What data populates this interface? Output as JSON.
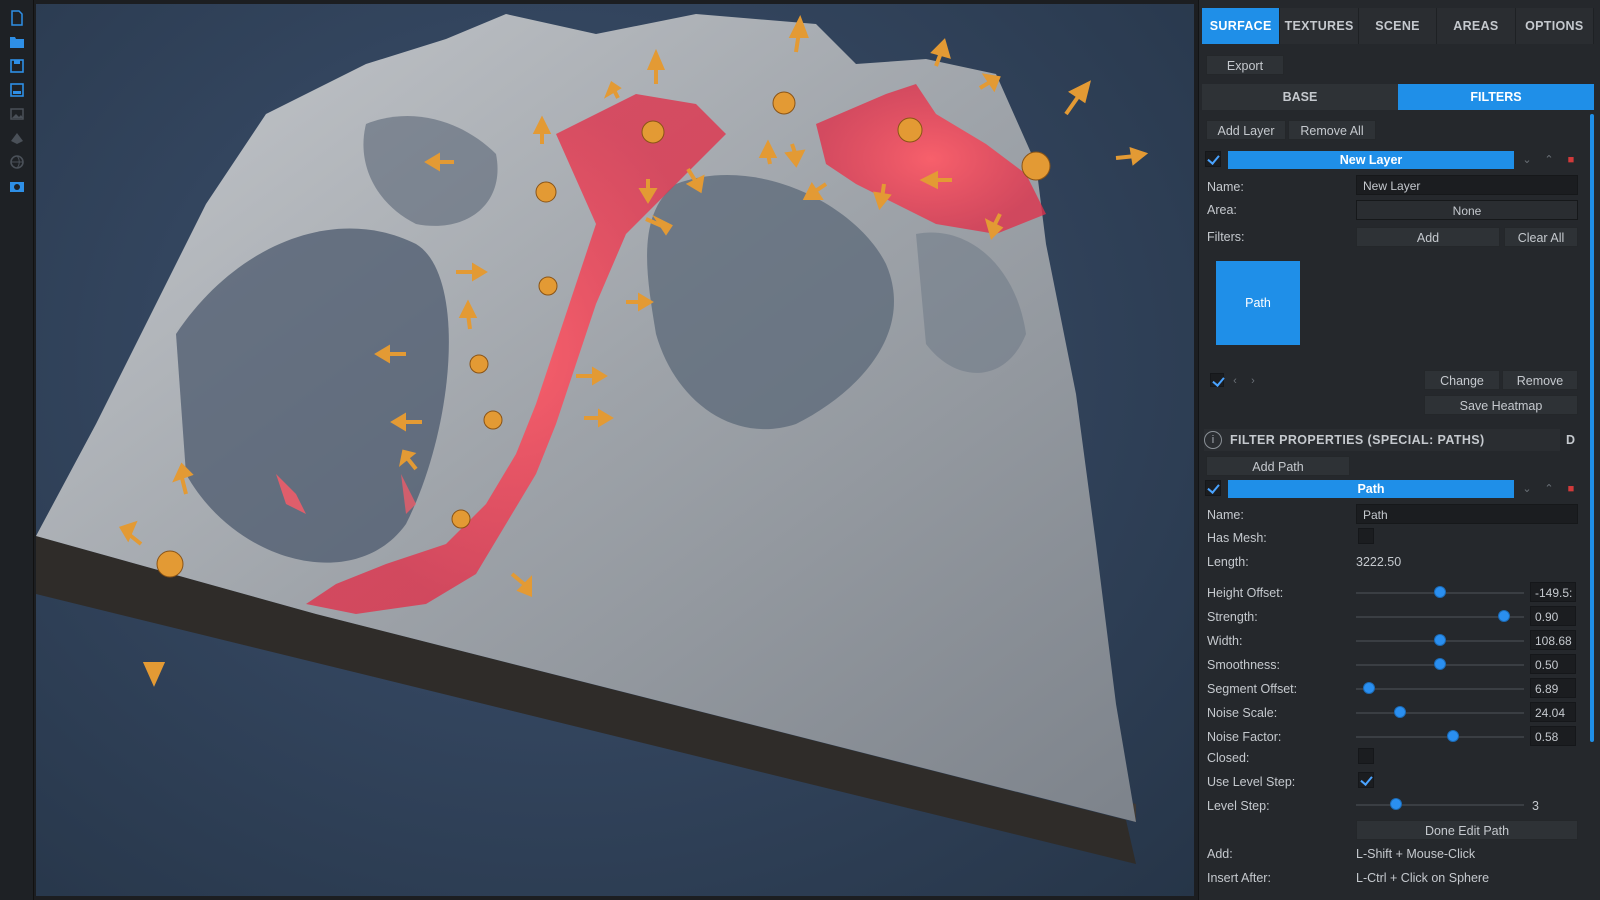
{
  "toolbar": {
    "tools": [
      {
        "name": "new-file-icon"
      },
      {
        "name": "open-folder-icon"
      },
      {
        "name": "save-icon"
      },
      {
        "name": "save-as-icon"
      },
      {
        "name": "image-icon"
      },
      {
        "name": "mesh-icon"
      },
      {
        "name": "globe-icon"
      },
      {
        "name": "camera-icon"
      }
    ]
  },
  "tabs": [
    {
      "label": "SURFACE",
      "active": true
    },
    {
      "label": "TEXTURES",
      "active": false
    },
    {
      "label": "SCENE",
      "active": false
    },
    {
      "label": "AREAS",
      "active": false
    },
    {
      "label": "OPTIONS",
      "active": false
    }
  ],
  "export_label": "Export",
  "subtabs": [
    {
      "label": "BASE",
      "active": false
    },
    {
      "label": "FILTERS",
      "active": true
    }
  ],
  "layer_actions": {
    "add": "Add Layer",
    "remove_all": "Remove All"
  },
  "layer": {
    "title": "New Layer",
    "enabled": true,
    "name_label": "Name:",
    "name_value": "New Layer",
    "area_label": "Area:",
    "area_value": "None",
    "filters_label": "Filters:",
    "add_label": "Add",
    "clear_all_label": "Clear All",
    "filter_item": "Path",
    "change_label": "Change",
    "remove_label": "Remove",
    "save_heatmap_label": "Save Heatmap"
  },
  "filter_properties": {
    "title": "FILTER PROPERTIES (SPECIAL: PATHS)",
    "d_label": "D",
    "add_path_label": "Add Path",
    "path_title": "Path",
    "name_label": "Name:",
    "name_value": "Path",
    "has_mesh_label": "Has Mesh:",
    "has_mesh": false,
    "length_label": "Length:",
    "length_value": "3222.50",
    "sliders": [
      {
        "label": "Height Offset:",
        "value": "-149.5:",
        "fraction": 0.5
      },
      {
        "label": "Strength:",
        "value": "0.90",
        "fraction": 0.88
      },
      {
        "label": "Width:",
        "value": "108.68",
        "fraction": 0.5
      },
      {
        "label": "Smoothness:",
        "value": "0.50",
        "fraction": 0.5
      },
      {
        "label": "Segment Offset:",
        "value": "6.89",
        "fraction": 0.08
      },
      {
        "label": "Noise Scale:",
        "value": "24.04",
        "fraction": 0.26
      },
      {
        "label": "Noise Factor:",
        "value": "0.58",
        "fraction": 0.58
      }
    ],
    "closed_label": "Closed:",
    "closed": false,
    "use_level_step_label": "Use Level Step:",
    "use_level_step": true,
    "level_step_label": "Level Step:",
    "level_step_value": "3",
    "level_step_fraction": 0.24,
    "done_edit_label": "Done Edit Path",
    "add_hint_label": "Add:",
    "add_hint_value": "L-Shift + Mouse-Click",
    "insert_after_label": "Insert After:",
    "insert_after_value": "L-Ctrl + Click on Sphere"
  },
  "colors": {
    "accent": "#1f8fe8",
    "highlight": "#ff4d5a",
    "handle": "#e8a03a"
  }
}
